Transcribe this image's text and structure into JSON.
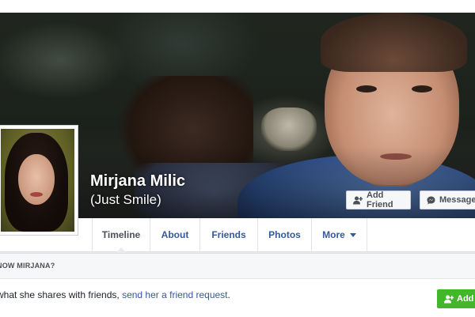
{
  "profile": {
    "name": "Mirjana Milic",
    "alternate_name": "(Just Smile)"
  },
  "cover_actions": {
    "add_friend_label": "Add Friend",
    "message_label": "Message"
  },
  "nav": {
    "tabs": [
      {
        "label": "Timeline",
        "active": true
      },
      {
        "label": "About"
      },
      {
        "label": "Friends"
      },
      {
        "label": "Photos"
      },
      {
        "label": "More"
      }
    ]
  },
  "know_panel": {
    "title": "NOW MIRJANA?",
    "text": "what she shares with friends, ",
    "link": "send her a friend request",
    "text_end": ".",
    "add_button_label": "Add"
  },
  "icons": [
    "add-friend-icon",
    "message-icon",
    "dropdown-caret-icon",
    "add-friend-icon"
  ],
  "colors": {
    "link": "#365899",
    "add_button": "#42b72a",
    "page_background": "#e9ebee"
  }
}
